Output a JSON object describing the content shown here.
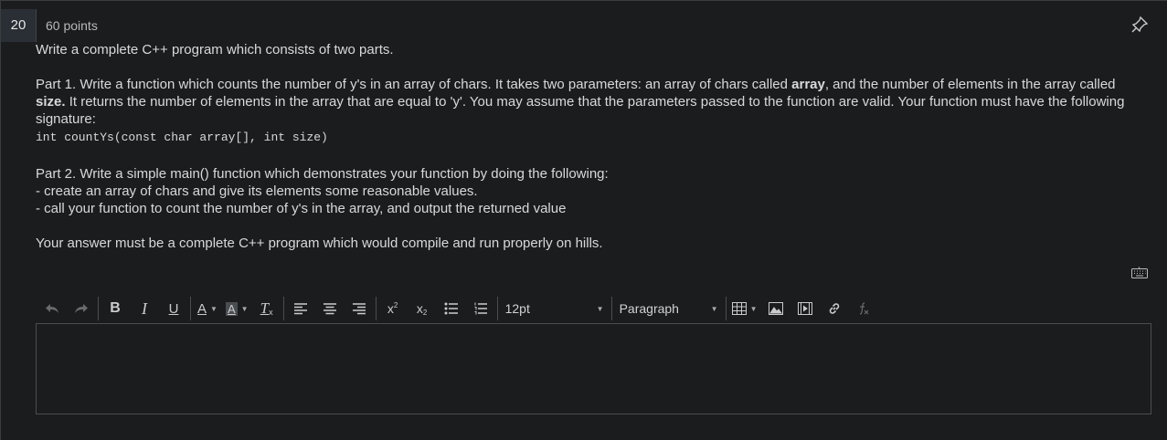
{
  "question": {
    "number": "20",
    "points": "60 points",
    "intro": "Write a complete C++ program which consists of two parts.",
    "part1": {
      "t1": "Part 1. Write a function which counts the number of y's in an array of chars.  It takes two parameters: an array of chars called ",
      "b1": "array",
      "t2": ", and the number of elements in the array called ",
      "b2": "size.",
      "t3": "  It returns the number of elements in the array that are equal to 'y'.  You may assume that the parameters passed to the function are valid.  Your function must have the following signature:"
    },
    "signature": "int countYs(const char array[], int size)",
    "part2": {
      "line1": "Part 2.  Write a simple main() function which demonstrates your function by doing the following:",
      "line2": "- create an array of chars and give its elements some reasonable values.",
      "line3": "- call your function to count the number of y's in the array, and output the returned value"
    },
    "closing": "Your answer must be a complete C++ program which would compile and run properly on hills."
  },
  "toolbar": {
    "font_size": "12pt",
    "block_format": "Paragraph",
    "buttons": {
      "bold": "B",
      "italic": "I",
      "underline": "U",
      "text_color": "A",
      "highlight": "A",
      "clear_format": "T",
      "superscript": "x",
      "subscript": "x"
    }
  },
  "icons": [
    "pin-icon",
    "keyboard-icon",
    "undo-icon",
    "redo-icon",
    "align-left-icon",
    "align-center-icon",
    "align-right-icon",
    "bullet-list-icon",
    "numbered-list-icon",
    "table-icon",
    "image-icon",
    "media-icon",
    "link-icon",
    "math-icon"
  ],
  "colors": {
    "background": "#1b1c1e",
    "text": "#d8d9db",
    "border": "#4a4d50",
    "number_badge": "#2a2f35"
  }
}
